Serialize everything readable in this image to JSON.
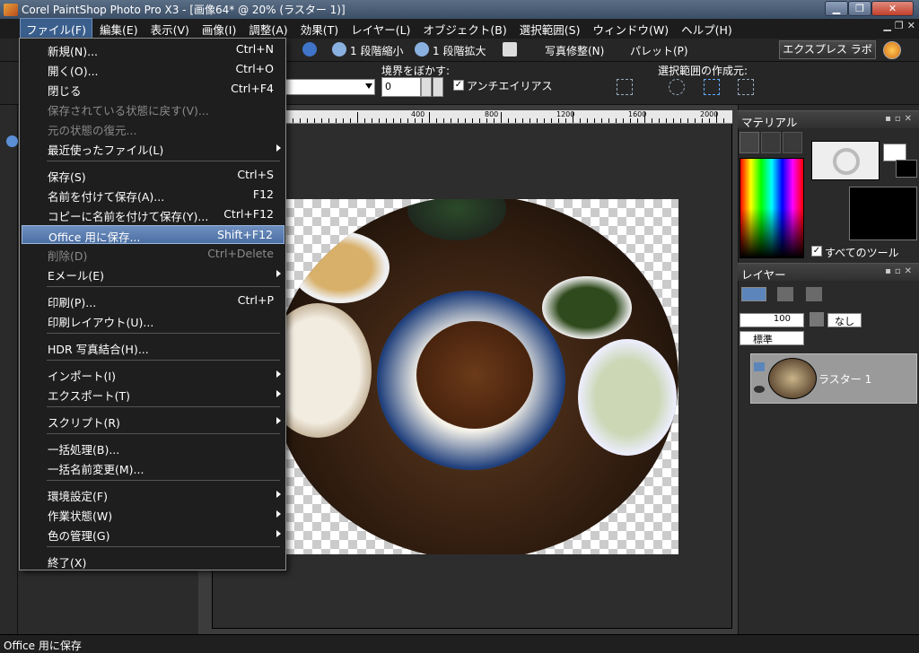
{
  "window": {
    "title": "Corel PaintShop Photo Pro X3 - [画像64* @  20% (ラスター 1)]",
    "controls": [
      "▁",
      "❐",
      "✕"
    ]
  },
  "menubar": {
    "items": [
      "ファイル(F)",
      "編集(E)",
      "表示(V)",
      "画像(I)",
      "調整(A)",
      "効果(T)",
      "レイヤー(L)",
      "オブジェクト(B)",
      "選択範囲(S)",
      "ウィンドウ(W)",
      "ヘルプ(H)"
    ],
    "mdi_controls": [
      "▁",
      "❐",
      "✕"
    ]
  },
  "toolbar": {
    "zoom_out": "1 段階縮小",
    "zoom_in": "1 段階拡大",
    "photo_fix": "写真修整(N)",
    "palette": "パレット(P)",
    "express_lab": "エクスプレス ラボ"
  },
  "tool_options": {
    "feather_label": "境界をぼかす:",
    "feather_value": "0",
    "antialias_label": "アンチエイリアス",
    "selection_from_label": "選択範囲の作成元:"
  },
  "file_menu": {
    "items": [
      {
        "label": "新規(N)...",
        "shortcut": "Ctrl+N"
      },
      {
        "label": "開く(O)...",
        "shortcut": "Ctrl+O"
      },
      {
        "label": "閉じる",
        "shortcut": "Ctrl+F4"
      },
      {
        "label": "保存されている状態に戻す(V)...",
        "shortcut": ""
      },
      {
        "label": "元の状態の復元...",
        "shortcut": ""
      },
      {
        "label": "最近使ったファイル(L)",
        "shortcut": ""
      },
      {
        "label": "保存(S)",
        "shortcut": "Ctrl+S"
      },
      {
        "label": "名前を付けて保存(A)...",
        "shortcut": "F12"
      },
      {
        "label": "コピーに名前を付けて保存(Y)...",
        "shortcut": "Ctrl+F12"
      },
      {
        "label": "Office 用に保存...",
        "shortcut": "Shift+F12"
      },
      {
        "label": "削除(D)",
        "shortcut": "Ctrl+Delete"
      },
      {
        "label": "Eメール(E)",
        "shortcut": ""
      },
      {
        "label": "印刷(P)...",
        "shortcut": "Ctrl+P"
      },
      {
        "label": "印刷レイアウト(U)...",
        "shortcut": ""
      },
      {
        "label": "HDR 写真結合(H)...",
        "shortcut": ""
      },
      {
        "label": "インポート(I)",
        "shortcut": ""
      },
      {
        "label": "エクスポート(T)",
        "shortcut": ""
      },
      {
        "label": "スクリプト(R)",
        "shortcut": ""
      },
      {
        "label": "一括処理(B)...",
        "shortcut": ""
      },
      {
        "label": "一括名前変更(M)...",
        "shortcut": ""
      },
      {
        "label": "環境設定(F)",
        "shortcut": ""
      },
      {
        "label": "作業状態(W)",
        "shortcut": ""
      },
      {
        "label": "色の管理(G)",
        "shortcut": ""
      },
      {
        "label": "終了(X)",
        "shortcut": ""
      }
    ]
  },
  "ruler": {
    "labels": [
      "400",
      "800",
      "1200",
      "1600",
      "2000"
    ]
  },
  "materials_panel": {
    "title": "マテリアル",
    "all_tools_label": "すべてのツール"
  },
  "layers_panel": {
    "title": "レイヤー",
    "opacity": "100",
    "blend_mode": "標準",
    "mask_label": "なし",
    "layer_name": "ラスター 1"
  },
  "statusbar": {
    "text": "Office 用に保存"
  },
  "colors": {
    "menu_highlight": "#4c6fa3",
    "title_bar": "#3b4e66"
  }
}
